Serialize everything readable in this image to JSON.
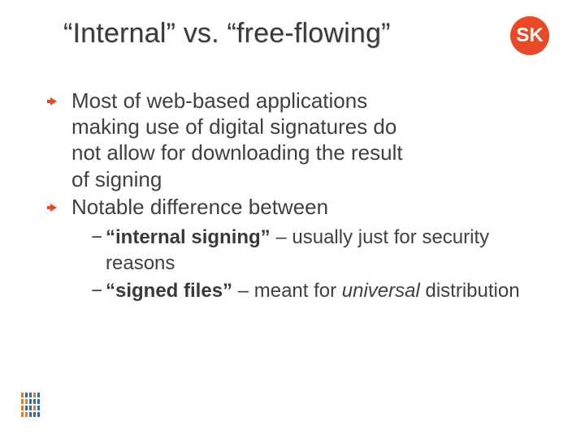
{
  "title": "“Internal” vs. “free-flowing”",
  "logo": "SK",
  "bullets": [
    "Most of web-based applications making use of digital signatures do not allow for downloading the result of signing",
    "Notable difference between"
  ],
  "sub": [
    {
      "dash": "− ",
      "bold": "“internal signing”",
      "rest": " – usually just for security reasons"
    },
    {
      "dash": "− ",
      "bold": "“signed files”",
      "rest_a": " – meant for ",
      "ital": "universal",
      "rest_b": " distribution"
    }
  ]
}
